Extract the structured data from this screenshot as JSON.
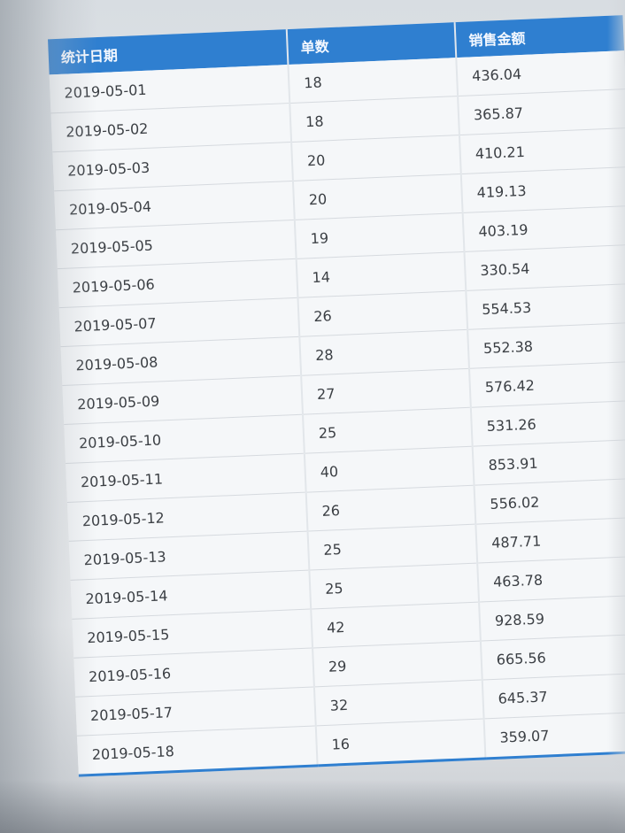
{
  "table": {
    "headers": [
      "统计日期",
      "单数",
      "销售金额"
    ],
    "rows": [
      {
        "date": "2019-05-01",
        "count": "18",
        "amount": "436.04"
      },
      {
        "date": "2019-05-02",
        "count": "18",
        "amount": "365.87"
      },
      {
        "date": "2019-05-03",
        "count": "20",
        "amount": "410.21"
      },
      {
        "date": "2019-05-04",
        "count": "20",
        "amount": "419.13"
      },
      {
        "date": "2019-05-05",
        "count": "19",
        "amount": "403.19"
      },
      {
        "date": "2019-05-06",
        "count": "14",
        "amount": "330.54"
      },
      {
        "date": "2019-05-07",
        "count": "26",
        "amount": "554.53"
      },
      {
        "date": "2019-05-08",
        "count": "28",
        "amount": "552.38"
      },
      {
        "date": "2019-05-09",
        "count": "27",
        "amount": "576.42"
      },
      {
        "date": "2019-05-10",
        "count": "25",
        "amount": "531.26"
      },
      {
        "date": "2019-05-11",
        "count": "40",
        "amount": "853.91"
      },
      {
        "date": "2019-05-12",
        "count": "26",
        "amount": "556.02"
      },
      {
        "date": "2019-05-13",
        "count": "25",
        "amount": "487.71"
      },
      {
        "date": "2019-05-14",
        "count": "25",
        "amount": "463.78"
      },
      {
        "date": "2019-05-15",
        "count": "42",
        "amount": "928.59"
      },
      {
        "date": "2019-05-16",
        "count": "29",
        "amount": "665.56"
      },
      {
        "date": "2019-05-17",
        "count": "32",
        "amount": "645.37"
      },
      {
        "date": "2019-05-18",
        "count": "16",
        "amount": "359.07"
      }
    ]
  },
  "colors": {
    "header_bg": "#2f7fd0",
    "header_text": "#f4f8ff",
    "cell_text": "#3b3f44",
    "cell_bg": "#f5f7f9"
  }
}
